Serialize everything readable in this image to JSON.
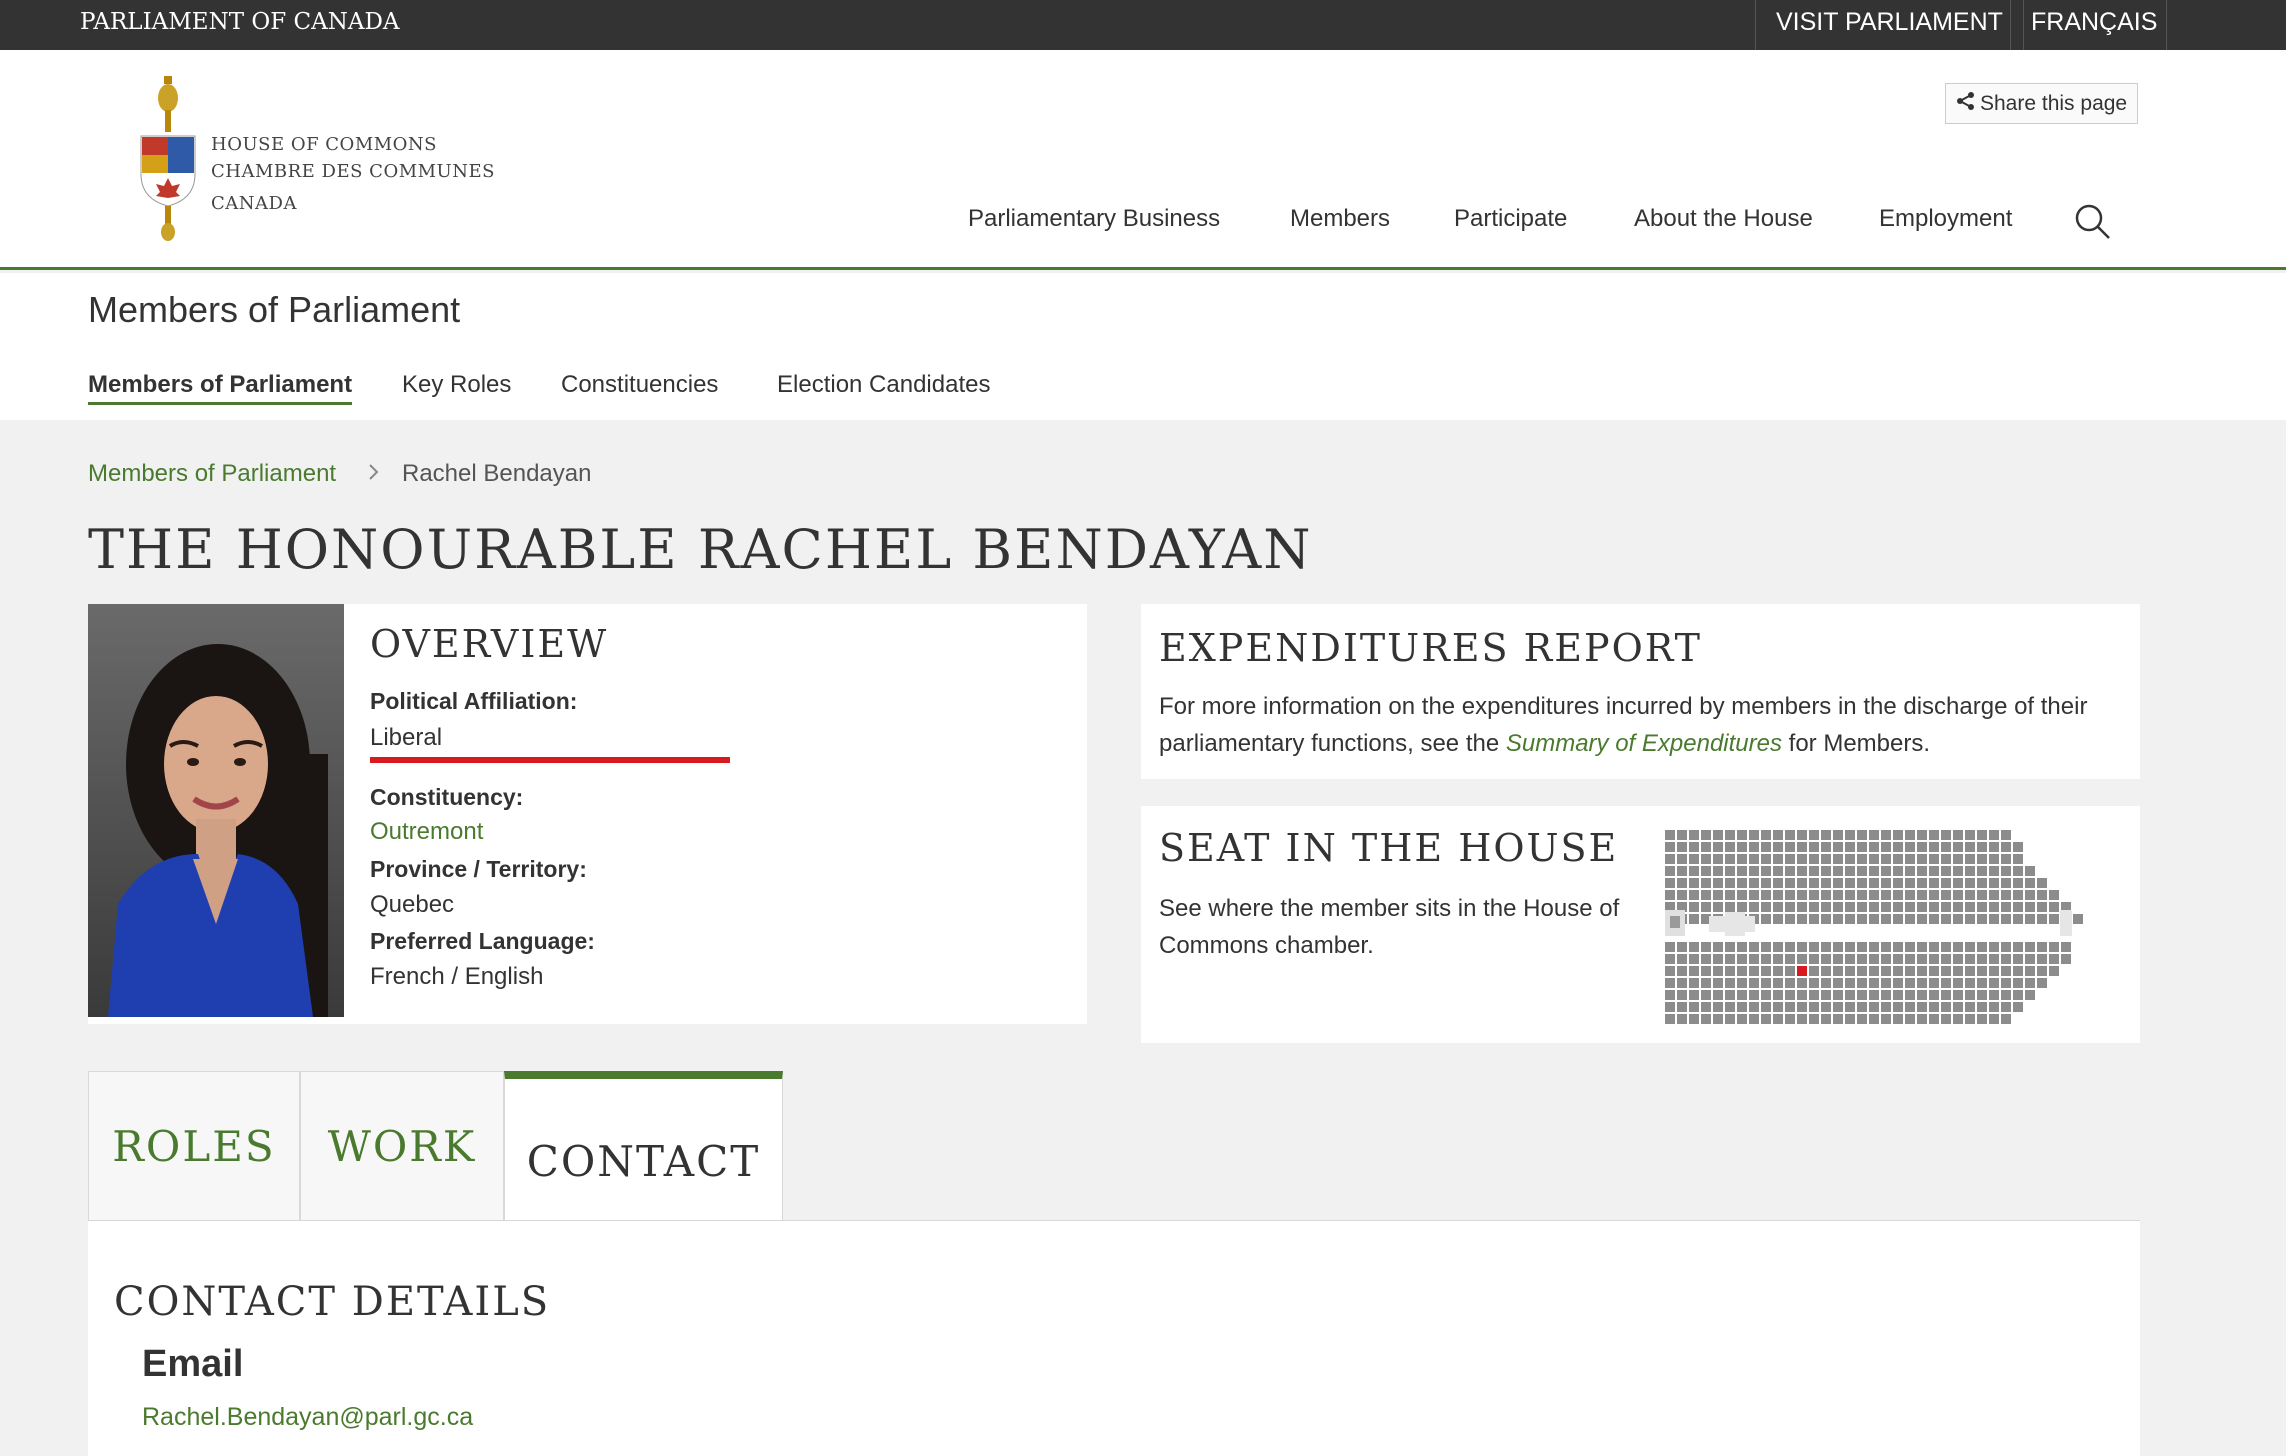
{
  "topbar": {
    "brand": "PARLIAMENT OF CANADA",
    "visit": "VISIT PARLIAMENT",
    "french": "FRANÇAIS"
  },
  "logo": {
    "line1": "HOUSE OF COMMONS",
    "line2": "CHAMBRE DES COMMUNES",
    "line3": "CANADA"
  },
  "share": {
    "label": "Share this page",
    "icon": "share-icon"
  },
  "main_nav": [
    "Parliamentary Business",
    "Members",
    "Participate",
    "About the House",
    "Employment"
  ],
  "section": {
    "title": "Members of Parliament",
    "tabs": [
      "Members of Parliament",
      "Key Roles",
      "Constituencies",
      "Election Candidates"
    ],
    "active_tab": "Members of Parliament"
  },
  "breadcrumb": {
    "link": "Members of Parliament",
    "current": "Rachel Bendayan"
  },
  "mp": {
    "title": "THE HONOURABLE RACHEL BENDAYAN"
  },
  "overview": {
    "title": "OVERVIEW",
    "affiliation_label": "Political Affiliation:",
    "affiliation": "Liberal",
    "party_color": "#d71920",
    "constituency_label": "Constituency:",
    "constituency": "Outremont",
    "province_label": "Province / Territory:",
    "province": "Quebec",
    "language_label": "Preferred Language:",
    "language": "French / English"
  },
  "expenditures": {
    "title": "EXPENDITURES REPORT",
    "text_before": "For more information on the expenditures incurred by members in the discharge of their parliamentary functions, see the",
    "link": "Summary of Expenditures",
    "text_after": "for Members."
  },
  "seat": {
    "title": "SEAT IN THE HOUSE",
    "text": "See where the member sits in the House of Commons chamber.",
    "highlight_color": "#d71920"
  },
  "tabs": {
    "roles": "ROLES",
    "work": "WORK",
    "contact": "CONTACT",
    "active": "CONTACT"
  },
  "contact": {
    "title": "CONTACT DETAILS",
    "email_label": "Email",
    "email": "Rachel.Bendayan@parl.gc.ca"
  },
  "colors": {
    "accent": "#4a7a2e",
    "topbar": "#333333"
  }
}
